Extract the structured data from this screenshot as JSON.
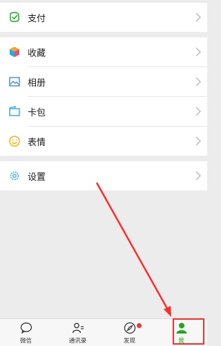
{
  "menu": {
    "group1": [
      {
        "label": "支付",
        "icon": "wallet-check-icon"
      }
    ],
    "group2": [
      {
        "label": "收藏",
        "icon": "cube-icon"
      },
      {
        "label": "相册",
        "icon": "photo-icon"
      },
      {
        "label": "卡包",
        "icon": "card-wallet-icon"
      },
      {
        "label": "表情",
        "icon": "smile-icon"
      }
    ],
    "group3": [
      {
        "label": "设置",
        "icon": "gear-icon"
      }
    ]
  },
  "tabbar": {
    "items": [
      {
        "label": "微信",
        "icon": "chat-bubble-icon"
      },
      {
        "label": "通讯录",
        "icon": "contacts-icon"
      },
      {
        "label": "发现",
        "icon": "compass-icon"
      },
      {
        "label": "我",
        "icon": "person-icon"
      }
    ],
    "active": "我"
  },
  "colors": {
    "accent_green": "#1aad19",
    "annotation_red": "#ff2a2a",
    "badge_red": "#f43530",
    "background": "#ececec"
  }
}
